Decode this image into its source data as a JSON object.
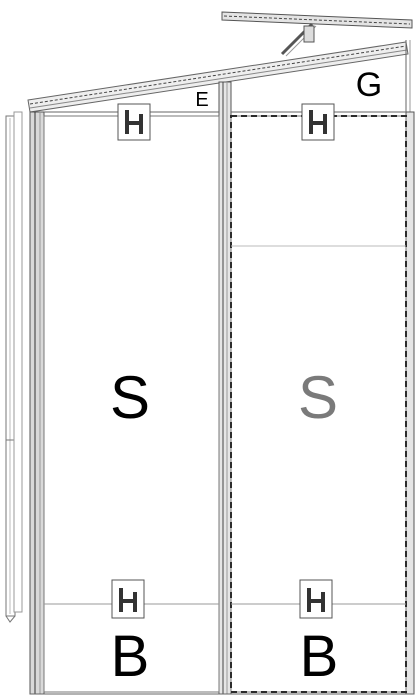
{
  "labels": {
    "roof_edge": "E",
    "gutter": "G",
    "panel_left": "S",
    "panel_right": "S",
    "base_left": "B",
    "base_right": "B"
  },
  "colors": {
    "line": "#6f6f6f",
    "dark_line": "#2b2b2b",
    "label_primary": "#000000",
    "label_muted": "#7a7a7a",
    "frame_fill": "#d9d9d9"
  },
  "icons": [
    "h-bracket-icon",
    "h-bracket-icon",
    "h-bracket-icon",
    "h-bracket-icon"
  ]
}
